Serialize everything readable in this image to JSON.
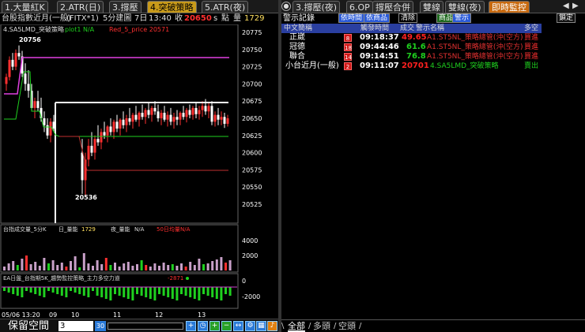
{
  "left_tabs": [
    "1.大量紅K",
    "2.ATR(日)",
    "3.撐壓",
    "4.突破策略",
    "5.ATR(夜)"
  ],
  "left_title": {
    "name": "台股指數近月(一般)",
    "code": "(FITX*1)",
    "period": "5分建圖",
    "date": "7日",
    "time": "13:40",
    "close_label": "收",
    "close_value": "20650",
    "s_label": "s",
    "point_label": "點",
    "qty_label": "量",
    "qty_value": "1729"
  },
  "chart_data": {
    "type": "candlestick",
    "legend": {
      "name": "4.SA5LMD_突破策略",
      "plot1": "plot1 N/A",
      "red": "Red_5_price 20571"
    },
    "y_ticks": [
      "20775",
      "20750",
      "20725",
      "20700",
      "20675",
      "20650",
      "20625",
      "20600",
      "20575",
      "20550",
      "20525"
    ],
    "annotations": {
      "high": "20756",
      "low": "20536"
    },
    "volume_panel": {
      "legend": [
        "台指成交量_5分K",
        "日_量能",
        "1729",
        "夜_量能",
        "N/A",
        "50日均量",
        "N/A"
      ],
      "y_ticks": [
        "4000",
        "2000"
      ]
    },
    "indicator_panel": {
      "legend": "EA日盤_台指期5K_趨勢監控策略_主力多空力道",
      "value": "-2871",
      "y_ticks": [
        "0",
        "-2000"
      ]
    },
    "x_ticks": [
      "05/06 13:20",
      "09",
      "10",
      "11",
      "12",
      "13"
    ]
  },
  "bottom_bar": {
    "label": "保留空間",
    "value": "3",
    "icons": [
      "zoom-in-icon",
      "zoom-out-icon",
      "add-icon",
      "subtract-icon",
      "expand-icon",
      "settings-icon",
      "chart-icon",
      "alert-icon"
    ]
  },
  "right_tabs": [
    "3.撐壓(夜)",
    "6.OP",
    "撐壓合併",
    "雙線",
    "雙線(夜)",
    "即時監控"
  ],
  "right_toolbar": {
    "title": "警示記錄",
    "btn1": "依時間",
    "btn2": "依商品",
    "btn3": "清除",
    "btn4": "商品",
    "btn5": "警示",
    "btn6": "鎖定"
  },
  "right_header": [
    "中文簡稱",
    "觸發時間",
    "成交",
    "警示名稱",
    "多空"
  ],
  "alerts": [
    {
      "name": "正崴",
      "badge": "8",
      "time": "09:18:37",
      "price": "49.65",
      "alert": "A1.ST5NL_策略總管(沖(空方)",
      "side": "買進"
    },
    {
      "name": "冠德",
      "badge": "18",
      "time": "09:44:46",
      "price": "61.6",
      "alert": "A1.ST5NL_策略總管(沖(空方)",
      "side": "買進"
    },
    {
      "name": "聯合",
      "badge": "14",
      "time": "09:14:51",
      "price": "76.8",
      "alert": "A1.ST5NL_策略總管(沖(空方)",
      "side": "買進"
    },
    {
      "name": "小台近月(一般)",
      "badge": "2",
      "time": "09:11:07",
      "price": "20701",
      "alert": "4.SA5LMD_突破策略",
      "side": "賣出"
    }
  ],
  "right_foot": [
    "全部",
    "多頭",
    "空頭"
  ],
  "colors": {
    "gold_tab": "#c89a1a",
    "orange_tab": "#c86a10",
    "header_blue": "#2a3fa0",
    "red": "#ff2020",
    "green": "#1fd01f",
    "magenta": "#e040e0"
  }
}
